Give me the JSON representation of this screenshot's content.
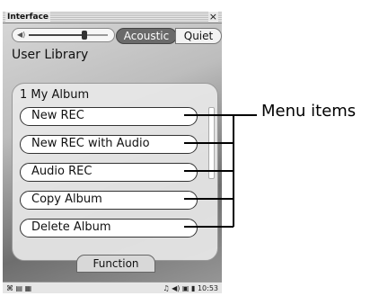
{
  "window": {
    "title": "Interface",
    "close_glyph": "×"
  },
  "volume": {
    "icon": "speaker-icon",
    "level": 0.7
  },
  "tabs": {
    "acoustic": "Acoustic",
    "quiet": "Quiet",
    "active": "Acoustic"
  },
  "library_label": "User Library",
  "album": "1 My Album",
  "menu": [
    "New REC",
    "New REC with Audio",
    "Audio REC",
    "Copy Album",
    "Delete Album"
  ],
  "function_label": "Function",
  "status": {
    "left_icons": [
      "camera-icon",
      "grid-icon",
      "memory-icon"
    ],
    "time": "10:53"
  },
  "annotation": {
    "label": "Menu items"
  }
}
